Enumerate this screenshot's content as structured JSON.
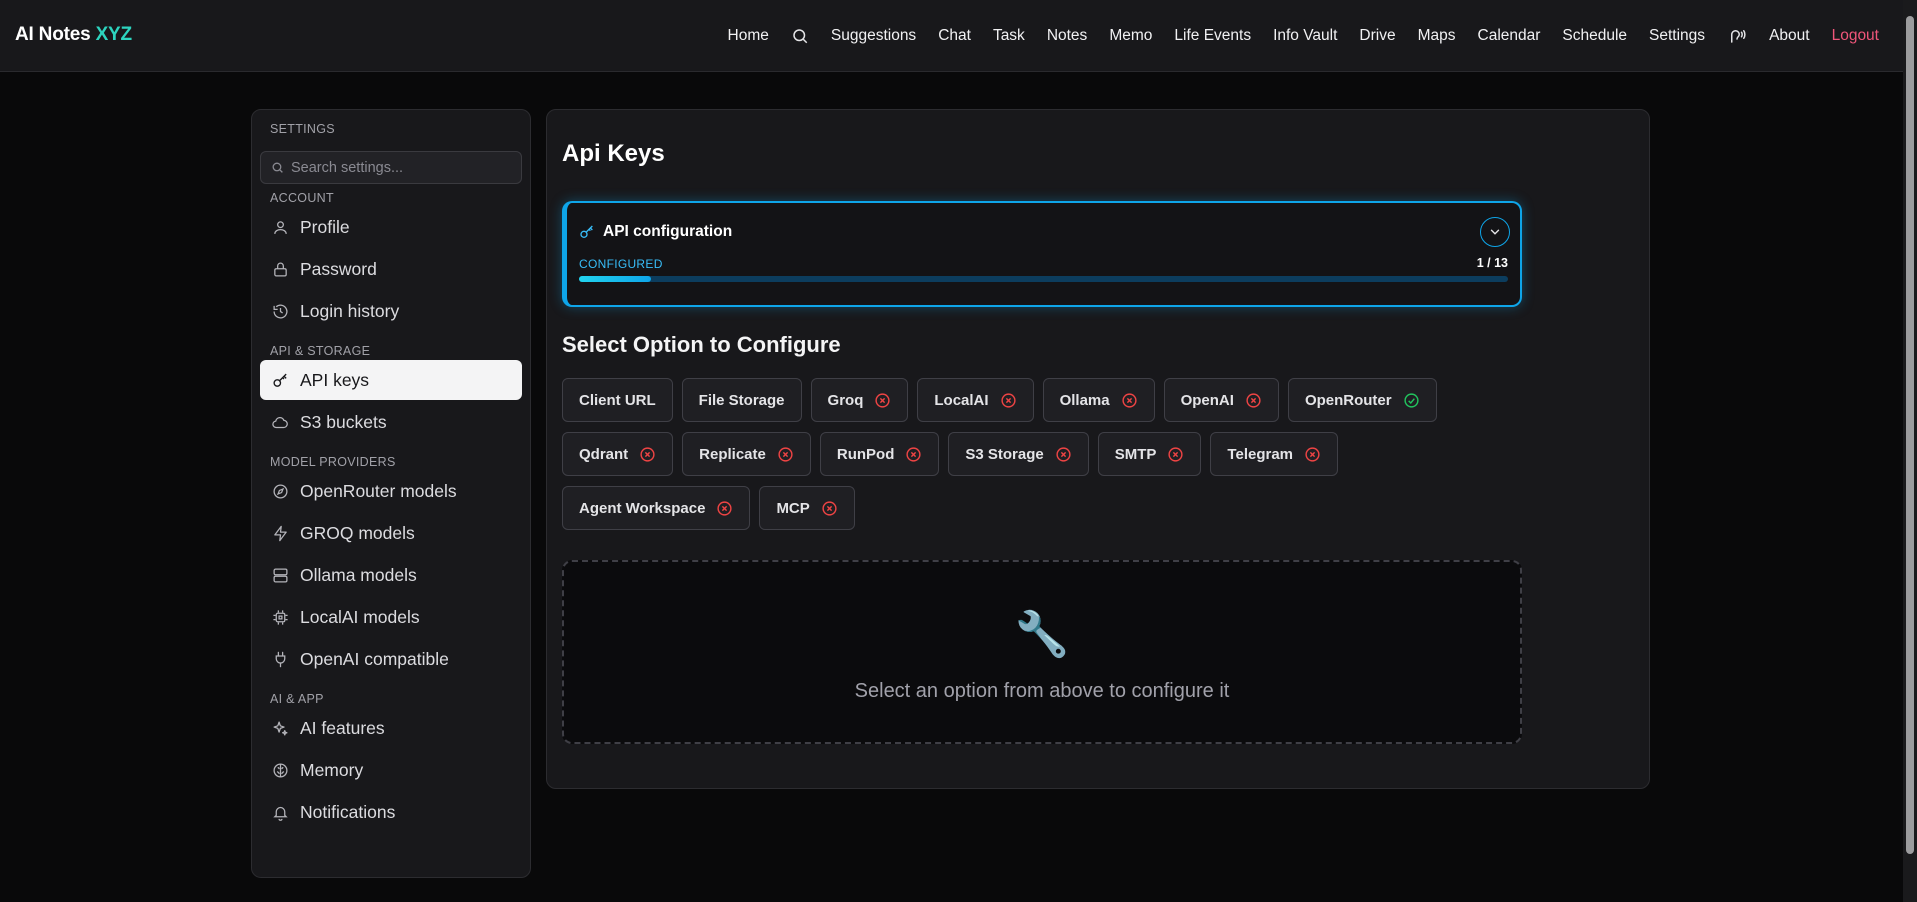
{
  "brand": {
    "name": "AI Notes",
    "accent": "XYZ"
  },
  "nav": {
    "home": "Home",
    "suggestions": "Suggestions",
    "chat": "Chat",
    "task": "Task",
    "notes": "Notes",
    "memo": "Memo",
    "life_events": "Life Events",
    "info_vault": "Info Vault",
    "drive": "Drive",
    "maps": "Maps",
    "calendar": "Calendar",
    "schedule": "Schedule",
    "settings": "Settings",
    "about": "About",
    "logout": "Logout"
  },
  "sidebar": {
    "title": "SETTINGS",
    "search_placeholder": "Search settings...",
    "sections": {
      "account": "ACCOUNT",
      "api_storage": "API & STORAGE",
      "model_providers": "MODEL PROVIDERS",
      "ai_app": "AI & APP"
    },
    "items": {
      "profile": "Profile",
      "password": "Password",
      "login_history": "Login history",
      "api_keys": "API keys",
      "s3_buckets": "S3 buckets",
      "openrouter_models": "OpenRouter models",
      "groq_models": "GROQ models",
      "ollama_models": "Ollama models",
      "localai_models": "LocalAI models",
      "openai_compatible": "OpenAI compatible",
      "ai_features": "AI features",
      "memory": "Memory",
      "notifications": "Notifications"
    },
    "active_item": "API keys"
  },
  "main": {
    "title": "Api Keys",
    "api_card": {
      "title": "API configuration",
      "status": "CONFIGURED",
      "count": "1 / 13",
      "progress": 0.077
    },
    "section_title": "Select Option to Configure",
    "options": {
      "client_url": "Client URL",
      "file_storage": "File Storage",
      "groq": "Groq",
      "localai": "LocalAI",
      "ollama": "Ollama",
      "openai": "OpenAI",
      "openrouter": "OpenRouter",
      "qdrant": "Qdrant",
      "replicate": "Replicate",
      "runpod": "RunPod",
      "s3_storage": "S3 Storage",
      "smtp": "SMTP",
      "telegram": "Telegram",
      "agent_workspace": "Agent Workspace",
      "mcp": "MCP"
    },
    "placeholder": {
      "icon": "🔧",
      "message": "Select an option from above to configure it"
    }
  },
  "colors": {
    "accent_teal": "#2dd4bf",
    "logout": "#f0567a",
    "cyan": "#0ea5e9",
    "error": "#ef4444",
    "success": "#22c55e"
  }
}
